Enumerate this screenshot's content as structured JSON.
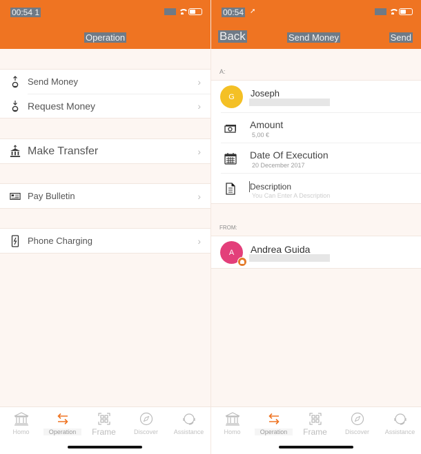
{
  "colors": {
    "accent": "#ef7422",
    "avatar_recipient": "#f4c025",
    "avatar_sender": "#e33f7a",
    "badge": "#e47b2a"
  },
  "left": {
    "status": {
      "time": "00:54 1"
    },
    "nav": {
      "title": "Operation"
    },
    "menu": [
      {
        "label": "Send Money",
        "icon": "send-money-icon"
      },
      {
        "label": "Request Money",
        "icon": "request-money-icon"
      },
      {
        "label": "Make Transfer",
        "icon": "bank-transfer-icon"
      },
      {
        "label": "Pay Bulletin",
        "icon": "bulletin-icon"
      },
      {
        "label": "Phone Charging",
        "icon": "phone-charging-icon"
      }
    ],
    "chevron": "›"
  },
  "right": {
    "status": {
      "time": "00:54",
      "location_glyph": "➚"
    },
    "nav": {
      "back": "Back",
      "title": "Send Money",
      "action": "Send"
    },
    "to_label": "A:",
    "recipient": {
      "initial": "G",
      "name": "Joseph"
    },
    "amount": {
      "label": "Amount",
      "value": "5,00 €"
    },
    "date": {
      "label": "Date Of Execution",
      "value": "20 December 2017"
    },
    "description": {
      "label": "Description",
      "placeholder": "You Can Enter A Description"
    },
    "from_label": "FROM:",
    "sender": {
      "initial": "A",
      "name": "Andrea Guida"
    }
  },
  "tabbar": {
    "tabs": [
      {
        "label": "Homo",
        "icon": "bank-icon"
      },
      {
        "label": "Operation",
        "icon": "transfer-arrows-icon",
        "active": true
      },
      {
        "label": "Frame",
        "icon": "qr-code-icon"
      },
      {
        "label": "Discover",
        "icon": "compass-icon"
      },
      {
        "label": "Assistance",
        "icon": "headset-icon"
      }
    ]
  }
}
